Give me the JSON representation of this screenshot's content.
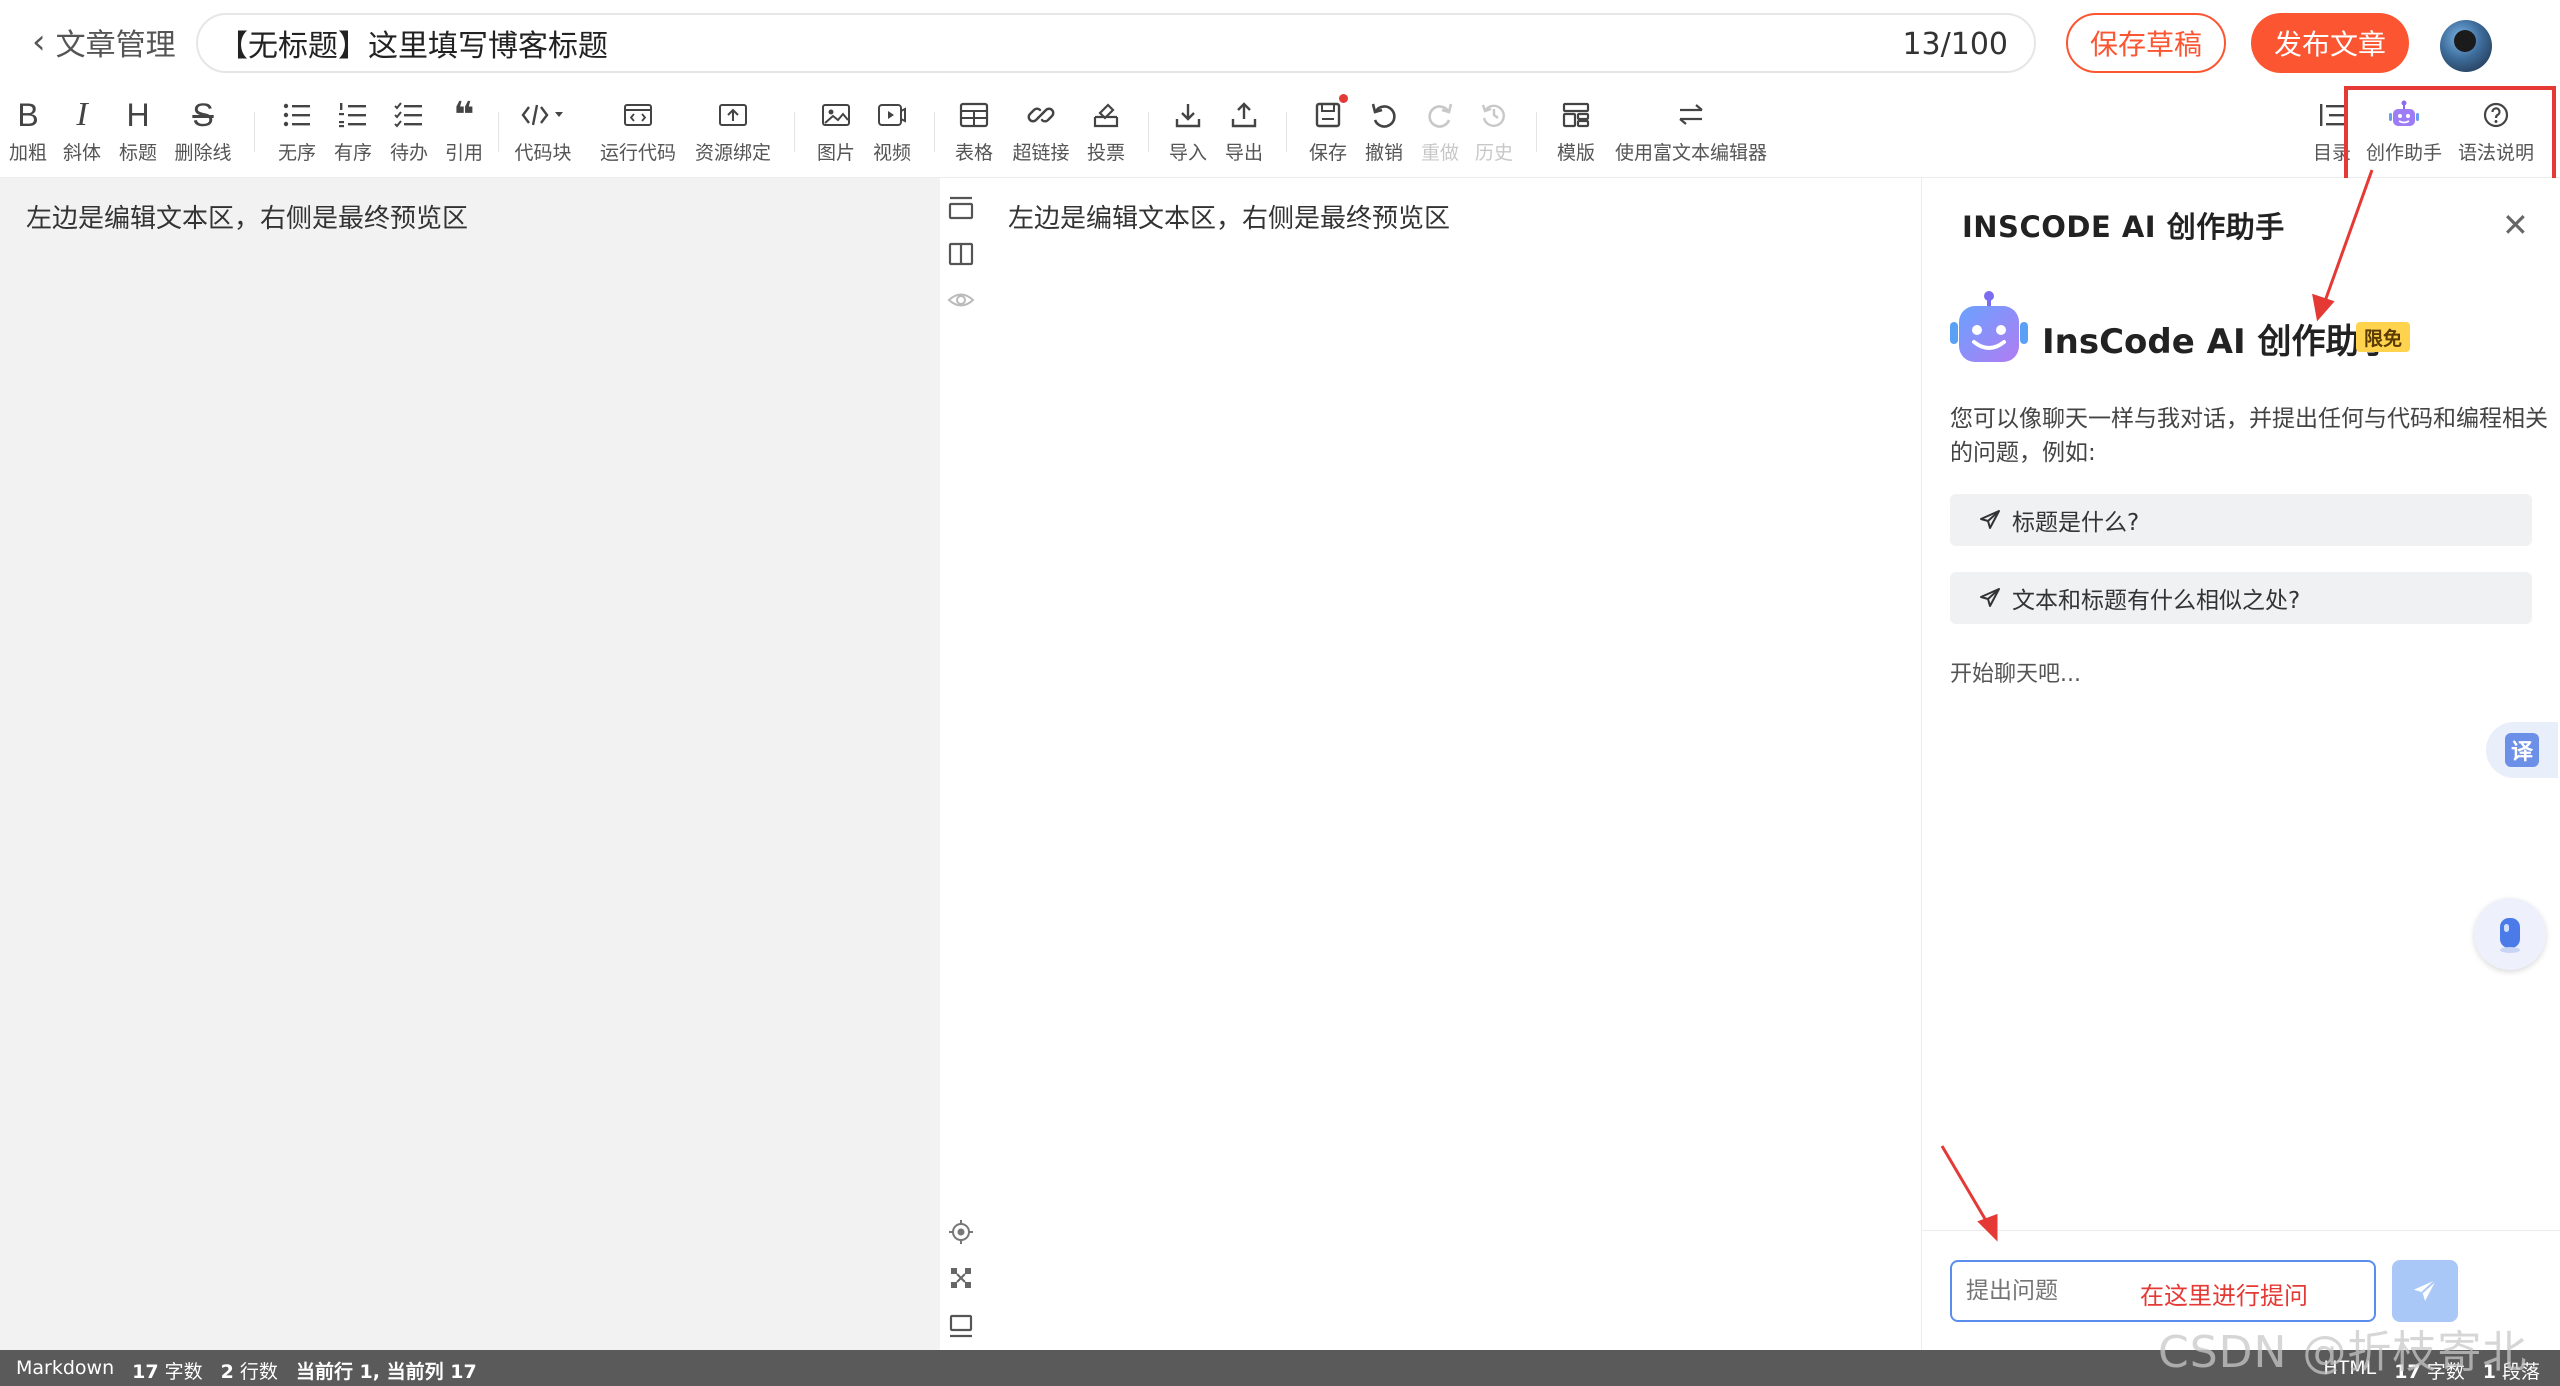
{
  "header": {
    "back_label": "文章管理",
    "title_value": "【无标题】这里填写博客标题",
    "title_count": "13/100",
    "save_draft": "保存草稿",
    "publish": "发布文章"
  },
  "toolbar": {
    "bold": "加粗",
    "italic": "斜体",
    "heading": "标题",
    "strike": "删除线",
    "unordered": "无序",
    "ordered": "有序",
    "todo": "待办",
    "quote": "引用",
    "codeblock": "代码块",
    "runcode": "运行代码",
    "resource": "资源绑定",
    "image": "图片",
    "video": "视频",
    "table": "表格",
    "hyperlink": "超链接",
    "vote": "投票",
    "import": "导入",
    "export": "导出",
    "save": "保存",
    "undo": "撤销",
    "redo": "重做",
    "history": "历史",
    "template": "模版",
    "richtext": "使用富文本编辑器",
    "toc": "目录",
    "ai_assistant": "创作助手",
    "syntax": "语法说明",
    "glyph_bold": "B",
    "glyph_italic": "I",
    "glyph_heading": "H",
    "glyph_strike": "S",
    "glyph_quote": "❝"
  },
  "editor": {
    "content": "左边是编辑文本区，右侧是最终预览区"
  },
  "preview": {
    "content": "左边是编辑文本区，右侧是最终预览区"
  },
  "ai_panel": {
    "header": "INSCODE AI 创作助手",
    "brand": "InsCode AI 创作助手",
    "badge": "限免",
    "intro": "您可以像聊天一样与我对话，并提出任何与代码和编程相关的问题，例如:",
    "suggestions": [
      "标题是什么?",
      "文本和标题有什么相似之处?"
    ],
    "start_chat": "开始聊天吧...",
    "input_placeholder": "提出问题",
    "input_hint": "在这里进行提问",
    "translate": "译"
  },
  "status_bar": {
    "mode": "Markdown",
    "word_count": "17",
    "word_unit": "字数",
    "line_count": "2",
    "line_unit": "行数",
    "cursor": "当前行 1, 当前列 17",
    "right_mode": "HTML",
    "right_words": "17",
    "right_word_unit": "字数",
    "right_paragraphs": "1",
    "right_para_unit": "段落"
  },
  "watermark": "CSDN @折枝寄北",
  "colors": {
    "brand_red": "#fc5531",
    "annotation_red": "#e53935",
    "input_border": "#5b8def",
    "send_button": "#a9c7f7"
  }
}
